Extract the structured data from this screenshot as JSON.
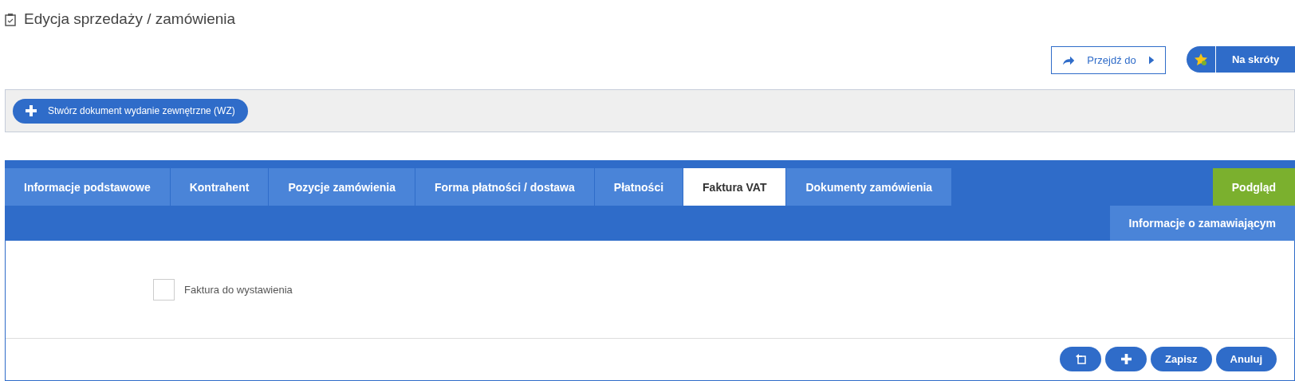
{
  "page": {
    "title": "Edycja sprzedaży / zamówienia"
  },
  "actions": {
    "goto": {
      "label": "Przejdź do"
    },
    "shortcuts": {
      "label": "Na skróty"
    }
  },
  "toolbar": {
    "buttons": [
      {
        "label": "Stwórz dokument wydanie zewnętrzne (WZ)"
      }
    ]
  },
  "tabs": [
    {
      "label": "Informacje podstawowe",
      "selected": false
    },
    {
      "label": "Kontrahent",
      "selected": false
    },
    {
      "label": "Pozycje zamówienia",
      "selected": false
    },
    {
      "label": "Forma płatności / dostawa",
      "selected": false
    },
    {
      "label": "Płatności",
      "selected": false
    },
    {
      "label": "Faktura VAT",
      "selected": true
    },
    {
      "label": "Dokumenty zamówienia",
      "selected": false
    }
  ],
  "side_tabs": [
    {
      "label": "Podgląd",
      "kind": "preview"
    },
    {
      "label": "Informacje o zamawiającym",
      "kind": "info"
    }
  ],
  "form": {
    "fields": [
      {
        "label": "Faktura do wystawienia",
        "checked": false
      }
    ]
  },
  "footer": {
    "buttons": [
      {
        "kind": "restore"
      },
      {
        "kind": "add"
      },
      {
        "kind": "text",
        "label": "Zapisz"
      },
      {
        "kind": "text",
        "label": "Anuluj"
      }
    ]
  }
}
